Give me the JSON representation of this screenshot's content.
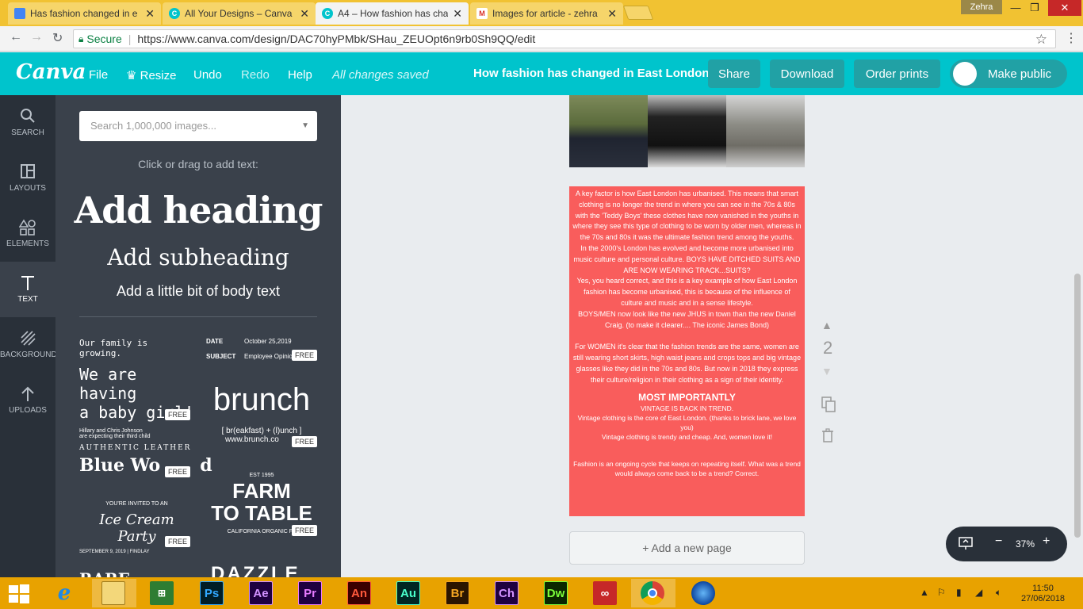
{
  "browser": {
    "tabs": [
      {
        "title": "Has fashion changed in e",
        "icon": "docs-icon",
        "color": "#4285f4",
        "active": false
      },
      {
        "title": "All Your Designs – Canva",
        "icon": "canva-icon",
        "color": "#00c4cc",
        "active": false
      },
      {
        "title": "A4 – How fashion has cha",
        "icon": "canva-icon",
        "color": "#00c4cc",
        "active": true
      },
      {
        "title": "Images for article - zehra",
        "icon": "gmail-icon",
        "color": "#d93025",
        "active": false
      }
    ],
    "user": "Zehra",
    "secure_label": "Secure",
    "url": "https://www.canva.com/design/DAC70hyPMbk/SHau_ZEUOpt6n9rb0Sh9QQ/edit"
  },
  "canva_header": {
    "logo": "Canva",
    "menu": {
      "file": "File",
      "resize": "Resize",
      "undo": "Undo",
      "redo": "Redo",
      "help": "Help"
    },
    "status": "All changes saved",
    "doc_title": "How fashion has changed in East London",
    "share": "Share",
    "download": "Download",
    "order_prints": "Order prints",
    "make_public": "Make public",
    "accent_color": "#00c4cc"
  },
  "rail": {
    "search": "SEARCH",
    "layouts": "LAYOUTS",
    "elements": "ELEMENTS",
    "text": "TEXT",
    "background": "BACKGROUND",
    "uploads": "UPLOADS"
  },
  "panel": {
    "search_placeholder": "Search 1,000,000 images...",
    "click_drag": "Click or drag to add text:",
    "add_heading": "Add heading",
    "add_subheading": "Add subheading",
    "add_body": "Add a little bit of body text",
    "free": "FREE",
    "templates": {
      "t1_line1": "Our family is growing.",
      "t1_line2": "We are having",
      "t1_line3": "a baby girl!",
      "t1_line4": "Hillary and Chris Johnson",
      "t1_line5": "are expecting their third child",
      "t2_date_label": "DATE",
      "t2_date": "October 25,2019",
      "t2_subject_label": "SUBJECT",
      "t2_subject": "Employee Opinio",
      "t3_word": "brunch",
      "t3_line": "[ br(eakfast) + (l)unch ]",
      "t3_url": "www.brunch.co",
      "t4_line1": "AUTHENTIC LEATHER",
      "t4_line2": "Blue Wo",
      "t4_line3": "d",
      "t5_est": "EST 1995",
      "t5_line1": "FARM",
      "t5_line2": "TO TABLE",
      "t5_line3": "CALIFORNIA ORGANIC FA",
      "t6_line1": "YOU'RE INVITED TO AN",
      "t6_line2": "Ice Cream Party",
      "t6_line3": "SEPTEMBER 9, 2019 | FINDLAY",
      "t7_partial": "RARE",
      "t8_partial": "DAZZLE"
    }
  },
  "page": {
    "background_color": "#f95d5c",
    "para1": "A key factor is how East London has urbanised. This means that smart clothing is no longer the trend in where you can see in the 70s & 80s with the 'Teddy Boys' these clothes have now vanished in the youths in where they see this type of clothing to be worn by older men, whereas in the 70s and 80s it was the ultimate fashion trend among the youths.",
    "para2": "In the 2000's London has evolved and become more urbanised into music culture and personal culture. BOYS HAVE DITCHED SUITS AND ARE NOW WEARING TRACK...SUITS?",
    "para3": "Yes, you heard correct, and this is a key example of how East London fashion has become urbanised, this is because of the influence of culture and music and in a sense lifestyle.",
    "para4": "BOYS/MEN  now look like the new JHUS in town than the new Daniel Craig. (to make it clearer.... The iconic James Bond)",
    "para5": "For WOMEN it's clear that the fashion trends are the same, women are still wearing short skirts, high waist jeans and crops tops and big vintage glasses like they did in the 70s and 80s. But now in 2018 they express their culture/religion in their clothing as a sign of their identity.",
    "heading": "MOST IMPORTANTLY",
    "line1": "VINTAGE IS BACK IN TREND.",
    "line2": "Vintage clothing is the core of East London. (thanks to brick lane, we love you)",
    "line3": "Vintage clothing is trendy and cheap. And, women love it!",
    "para6": "Fashion is an ongoing cycle that keeps on repeating itself. What was a trend would always come back to be a trend? Correct."
  },
  "canvas": {
    "page_number": "2",
    "add_page": "+ Add a new page",
    "zoom": "37%"
  },
  "taskbar": {
    "apps": [
      {
        "label": "Ps",
        "name": "photoshop-icon",
        "bg": "#001d26",
        "fg": "#31a8ff"
      },
      {
        "label": "Ae",
        "name": "after-effects-icon",
        "bg": "#1f0040",
        "fg": "#d291ff"
      },
      {
        "label": "Pr",
        "name": "premiere-icon",
        "bg": "#1f0040",
        "fg": "#e77bff"
      },
      {
        "label": "An",
        "name": "animate-icon",
        "bg": "#3b0000",
        "fg": "#ff5a3c"
      },
      {
        "label": "Au",
        "name": "audition-icon",
        "bg": "#002623",
        "fg": "#4affcc"
      },
      {
        "label": "Br",
        "name": "bridge-icon",
        "bg": "#2b1500",
        "fg": "#f5a623"
      },
      {
        "label": "Ch",
        "name": "character-animator-icon",
        "bg": "#1f0040",
        "fg": "#d291ff"
      },
      {
        "label": "Dw",
        "name": "dreamweaver-icon",
        "bg": "#0b2600",
        "fg": "#7cff3a"
      }
    ],
    "time": "11:50",
    "date": "27/06/2018"
  }
}
